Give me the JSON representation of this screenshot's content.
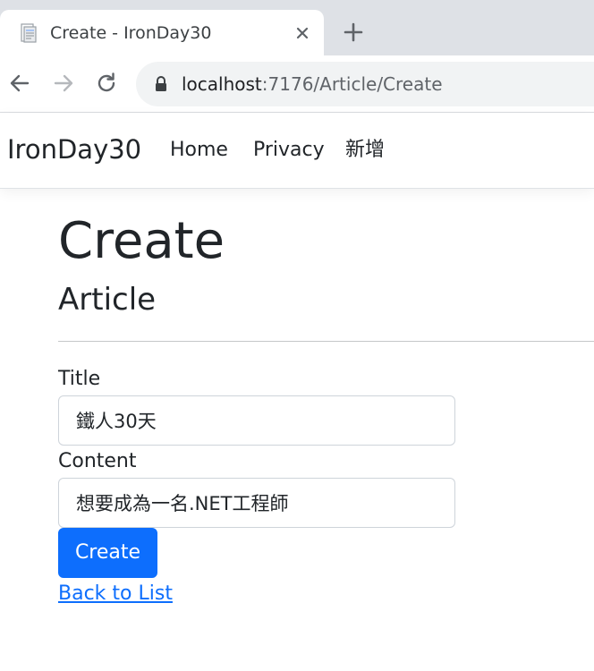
{
  "browser": {
    "tab": {
      "title": "Create - IronDay30",
      "favicon": "document-icon",
      "close": "close-icon"
    },
    "new_tab": "plus-icon",
    "toolbar": {
      "back": "arrow-left-icon",
      "forward": "arrow-right-icon",
      "reload": "reload-icon"
    },
    "address": {
      "lock": "lock-icon",
      "host": "localhost",
      "path": ":7176/Article/Create"
    }
  },
  "navbar": {
    "brand": "IronDay30",
    "links": [
      {
        "label": "Home"
      },
      {
        "label": "Privacy"
      },
      {
        "label": "新增"
      }
    ]
  },
  "page": {
    "heading": "Create",
    "subheading": "Article"
  },
  "form": {
    "title_label": "Title",
    "title_value": "鐵人30天",
    "content_label": "Content",
    "content_value": "想要成為一名.NET工程師",
    "submit_label": "Create"
  },
  "back_link": "Back to List",
  "colors": {
    "primary": "#0d6efd",
    "tabstrip": "#dee1e6",
    "omnibox": "#f1f3f4",
    "text": "#212529"
  }
}
